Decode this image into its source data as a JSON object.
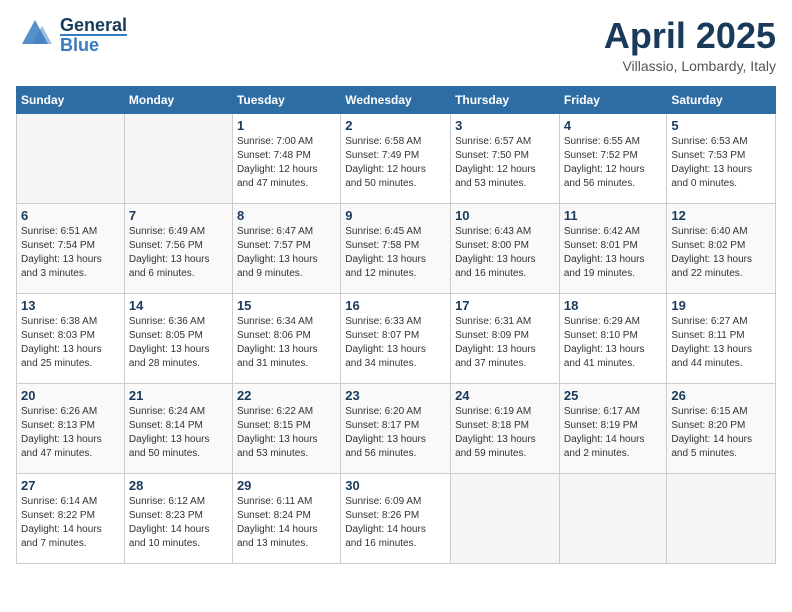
{
  "header": {
    "logo": {
      "general": "General",
      "blue": "Blue"
    },
    "title": "April 2025",
    "location": "Villassio, Lombardy, Italy"
  },
  "weekdays": [
    "Sunday",
    "Monday",
    "Tuesday",
    "Wednesday",
    "Thursday",
    "Friday",
    "Saturday"
  ],
  "weeks": [
    [
      {
        "day": "",
        "info": ""
      },
      {
        "day": "",
        "info": ""
      },
      {
        "day": "1",
        "info": "Sunrise: 7:00 AM\nSunset: 7:48 PM\nDaylight: 12 hours\nand 47 minutes."
      },
      {
        "day": "2",
        "info": "Sunrise: 6:58 AM\nSunset: 7:49 PM\nDaylight: 12 hours\nand 50 minutes."
      },
      {
        "day": "3",
        "info": "Sunrise: 6:57 AM\nSunset: 7:50 PM\nDaylight: 12 hours\nand 53 minutes."
      },
      {
        "day": "4",
        "info": "Sunrise: 6:55 AM\nSunset: 7:52 PM\nDaylight: 12 hours\nand 56 minutes."
      },
      {
        "day": "5",
        "info": "Sunrise: 6:53 AM\nSunset: 7:53 PM\nDaylight: 13 hours\nand 0 minutes."
      }
    ],
    [
      {
        "day": "6",
        "info": "Sunrise: 6:51 AM\nSunset: 7:54 PM\nDaylight: 13 hours\nand 3 minutes."
      },
      {
        "day": "7",
        "info": "Sunrise: 6:49 AM\nSunset: 7:56 PM\nDaylight: 13 hours\nand 6 minutes."
      },
      {
        "day": "8",
        "info": "Sunrise: 6:47 AM\nSunset: 7:57 PM\nDaylight: 13 hours\nand 9 minutes."
      },
      {
        "day": "9",
        "info": "Sunrise: 6:45 AM\nSunset: 7:58 PM\nDaylight: 13 hours\nand 12 minutes."
      },
      {
        "day": "10",
        "info": "Sunrise: 6:43 AM\nSunset: 8:00 PM\nDaylight: 13 hours\nand 16 minutes."
      },
      {
        "day": "11",
        "info": "Sunrise: 6:42 AM\nSunset: 8:01 PM\nDaylight: 13 hours\nand 19 minutes."
      },
      {
        "day": "12",
        "info": "Sunrise: 6:40 AM\nSunset: 8:02 PM\nDaylight: 13 hours\nand 22 minutes."
      }
    ],
    [
      {
        "day": "13",
        "info": "Sunrise: 6:38 AM\nSunset: 8:03 PM\nDaylight: 13 hours\nand 25 minutes."
      },
      {
        "day": "14",
        "info": "Sunrise: 6:36 AM\nSunset: 8:05 PM\nDaylight: 13 hours\nand 28 minutes."
      },
      {
        "day": "15",
        "info": "Sunrise: 6:34 AM\nSunset: 8:06 PM\nDaylight: 13 hours\nand 31 minutes."
      },
      {
        "day": "16",
        "info": "Sunrise: 6:33 AM\nSunset: 8:07 PM\nDaylight: 13 hours\nand 34 minutes."
      },
      {
        "day": "17",
        "info": "Sunrise: 6:31 AM\nSunset: 8:09 PM\nDaylight: 13 hours\nand 37 minutes."
      },
      {
        "day": "18",
        "info": "Sunrise: 6:29 AM\nSunset: 8:10 PM\nDaylight: 13 hours\nand 41 minutes."
      },
      {
        "day": "19",
        "info": "Sunrise: 6:27 AM\nSunset: 8:11 PM\nDaylight: 13 hours\nand 44 minutes."
      }
    ],
    [
      {
        "day": "20",
        "info": "Sunrise: 6:26 AM\nSunset: 8:13 PM\nDaylight: 13 hours\nand 47 minutes."
      },
      {
        "day": "21",
        "info": "Sunrise: 6:24 AM\nSunset: 8:14 PM\nDaylight: 13 hours\nand 50 minutes."
      },
      {
        "day": "22",
        "info": "Sunrise: 6:22 AM\nSunset: 8:15 PM\nDaylight: 13 hours\nand 53 minutes."
      },
      {
        "day": "23",
        "info": "Sunrise: 6:20 AM\nSunset: 8:17 PM\nDaylight: 13 hours\nand 56 minutes."
      },
      {
        "day": "24",
        "info": "Sunrise: 6:19 AM\nSunset: 8:18 PM\nDaylight: 13 hours\nand 59 minutes."
      },
      {
        "day": "25",
        "info": "Sunrise: 6:17 AM\nSunset: 8:19 PM\nDaylight: 14 hours\nand 2 minutes."
      },
      {
        "day": "26",
        "info": "Sunrise: 6:15 AM\nSunset: 8:20 PM\nDaylight: 14 hours\nand 5 minutes."
      }
    ],
    [
      {
        "day": "27",
        "info": "Sunrise: 6:14 AM\nSunset: 8:22 PM\nDaylight: 14 hours\nand 7 minutes."
      },
      {
        "day": "28",
        "info": "Sunrise: 6:12 AM\nSunset: 8:23 PM\nDaylight: 14 hours\nand 10 minutes."
      },
      {
        "day": "29",
        "info": "Sunrise: 6:11 AM\nSunset: 8:24 PM\nDaylight: 14 hours\nand 13 minutes."
      },
      {
        "day": "30",
        "info": "Sunrise: 6:09 AM\nSunset: 8:26 PM\nDaylight: 14 hours\nand 16 minutes."
      },
      {
        "day": "",
        "info": ""
      },
      {
        "day": "",
        "info": ""
      },
      {
        "day": "",
        "info": ""
      }
    ]
  ]
}
